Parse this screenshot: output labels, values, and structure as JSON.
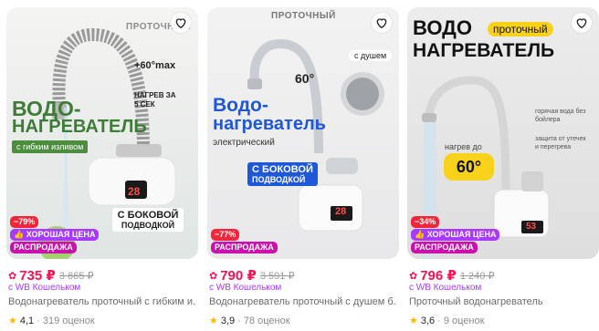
{
  "colors": {
    "accent": "#f91155",
    "discount": "#f0273b",
    "good_price": "#a73afd",
    "sale": "#cb11ab",
    "wallet": "#a73afd",
    "star": "#ffb800"
  },
  "products": [
    {
      "image": {
        "top_label": "ПРОТОЧНЫЙ",
        "temp": "+60°max",
        "heat_note": "НАГРЕВ ЗА 5 СЕК",
        "line1": "ВОДО-",
        "line2": "НАГРЕВАТЕЛЬ",
        "tag": "с гибким изливом",
        "side_line1": "С БОКОВОЙ",
        "side_line2": "ПОДВОДКОЙ",
        "display": "28"
      },
      "badges": {
        "discount": "−79%",
        "good_price": "ХОРОШАЯ ЦЕНА",
        "sale": "РАСПРОДАЖА"
      },
      "price": "735 ₽",
      "old_price": "3 665 ₽",
      "wallet": "с WB Кошельком",
      "title": "Водонагреватель проточный с гибким и...",
      "rating": "4,1",
      "reviews": "319 оценок"
    },
    {
      "image": {
        "top_label": "ПРОТОЧНЫЙ",
        "temp": "60°",
        "shower": "с душем",
        "line1": "Водо-",
        "line2": "нагреватель",
        "sub": "электрический",
        "side_line1": "С БОКОВОЙ",
        "side_line2": "ПОДВОДКОЙ",
        "display": "28"
      },
      "badges": {
        "discount": "−77%",
        "sale": "РАСПРОДАЖА"
      },
      "price": "790 ₽",
      "old_price": "3 591 ₽",
      "wallet": "с WB Кошельком",
      "title": "Водонагреватель проточный с душем б...",
      "rating": "3,9",
      "reviews": "78 оценок"
    },
    {
      "image": {
        "line1": "ВОДО",
        "tag": "проточный",
        "line2": "НАГРЕВАТЕЛЬ",
        "heat_up": "нагрев до",
        "temp": "60°",
        "note1": "горячая вода без бойлера",
        "note2": "защита от утечек и перегрева",
        "display": "53"
      },
      "badges": {
        "discount": "−34%",
        "good_price": "ХОРОШАЯ ЦЕНА",
        "sale": "РАСПРОДАЖА"
      },
      "price": "796 ₽",
      "old_price": "1 240 ₽",
      "wallet": "с WB Кошельком",
      "title": "Проточный водонагреватель",
      "rating": "3,6",
      "reviews": "9 оценок"
    }
  ]
}
